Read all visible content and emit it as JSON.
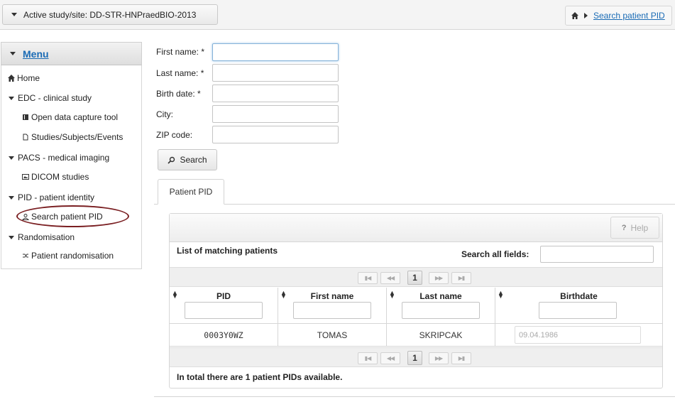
{
  "header": {
    "study_label": "Active study/site: DD-STR-HNPraedBIO-2013",
    "breadcrumb_link": "Search patient PID"
  },
  "sidebar": {
    "title": "Menu",
    "items": [
      {
        "label": "Home"
      },
      {
        "label": "EDC - clinical study"
      },
      {
        "label": "Open data capture tool"
      },
      {
        "label": "Studies/Subjects/Events"
      },
      {
        "label": "PACS - medical imaging"
      },
      {
        "label": "DICOM studies"
      },
      {
        "label": "PID - patient identity"
      },
      {
        "label": "Search patient PID"
      },
      {
        "label": "Randomisation"
      },
      {
        "label": "Patient randomisation"
      }
    ]
  },
  "form": {
    "first_name_label": "First name: *",
    "last_name_label": "Last name: *",
    "birth_date_label": "Birth date: *",
    "city_label": "City:",
    "zip_label": "ZIP code:",
    "first_name_value": "",
    "last_name_value": "",
    "birth_date_value": "",
    "city_value": "",
    "zip_value": "",
    "search_button": "Search"
  },
  "tabs": [
    {
      "label": "Patient PID"
    }
  ],
  "panel": {
    "help_button": "Help",
    "help_icon": "?",
    "list_title": "List of matching patients",
    "search_all_label": "Search all fields:",
    "search_all_value": "",
    "paginator": {
      "first": "▮◀",
      "prev": "◀◀",
      "page": "1",
      "next": "▶▶",
      "last": "▶▮"
    },
    "columns": [
      "PID",
      "First name",
      "Last name",
      "Birthdate"
    ],
    "rows": [
      {
        "pid": "0003Y0WZ",
        "first_name": "TOMAS",
        "last_name": "SKRIPCAK",
        "birthdate": "09.04.1986"
      }
    ],
    "total_text": "In total there are 1 patient PIDs available."
  },
  "colors": {
    "link": "#1a6bb5",
    "annotation_ellipse": "#7a1f22"
  }
}
